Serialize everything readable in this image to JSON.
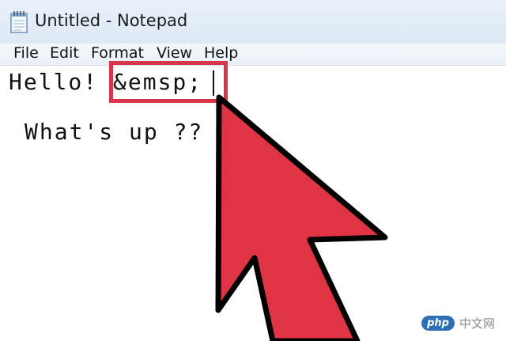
{
  "window": {
    "title": "Untitled - Notepad",
    "icon": "notepad-icon"
  },
  "menu": {
    "items": [
      "File",
      "Edit",
      "Format",
      "View",
      "Help"
    ]
  },
  "editor": {
    "line1": "Hello! &emsp;",
    "line2": "What's up ??"
  },
  "annotation": {
    "highlight_color": "#d8344a",
    "cursor_color": "#de3444",
    "cursor_icon": "arrow-cursor-icon"
  },
  "watermark": {
    "logo": "php",
    "text": "中文网"
  }
}
